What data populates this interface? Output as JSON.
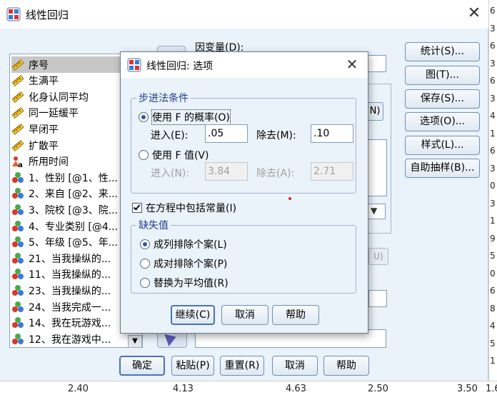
{
  "main": {
    "title": "线性回归",
    "dependent_label": "因变量(D):",
    "block_next_label": "N)",
    "method_arrow": "▼",
    "rule_button_label": "U)",
    "variables": [
      {
        "label": "序号",
        "type": "scale",
        "selected": true
      },
      {
        "label": "生满平",
        "type": "scale"
      },
      {
        "label": "化身认同平均",
        "type": "scale"
      },
      {
        "label": "同一延缓平",
        "type": "scale"
      },
      {
        "label": "早闭平",
        "type": "scale"
      },
      {
        "label": "扩散平",
        "type": "scale"
      },
      {
        "label": "所用时间",
        "type": "string"
      },
      {
        "label": "1、性别 [@1、性...",
        "type": "nominal"
      },
      {
        "label": "2、来自 [@2、来...",
        "type": "nominal"
      },
      {
        "label": "3、院校 [@3、院...",
        "type": "nominal"
      },
      {
        "label": "4、专业类别 [@4...",
        "type": "nominal"
      },
      {
        "label": "5、年级 [@5、年...",
        "type": "nominal"
      },
      {
        "label": "21、当我操纵的...",
        "type": "nominal"
      },
      {
        "label": "11、当我操纵的...",
        "type": "nominal"
      },
      {
        "label": "23、当我操纵的...",
        "type": "nominal"
      },
      {
        "label": "24、当我完成一...",
        "type": "nominal"
      },
      {
        "label": "14、我在玩游戏...",
        "type": "nominal"
      },
      {
        "label": "12、我在游戏中...",
        "type": "nominal"
      }
    ],
    "side_buttons": [
      "统计(S)...",
      "图(T)...",
      "保存(S)...",
      "选项(O)...",
      "样式(L)...",
      "自助抽样(B)..."
    ],
    "bottom_buttons": [
      "确定",
      "粘贴(P)",
      "重置(R)",
      "取消",
      "帮助"
    ]
  },
  "options": {
    "title": "线性回归: 选项",
    "stepping_group": "步进法条件",
    "use_prob_label": "使用 F 的概率(O)",
    "entry_label": "进入(E):",
    "entry_value": ".05",
    "removal_label": "除去(M):",
    "removal_value": ".10",
    "use_f_value_label": "使用 F 值(V)",
    "entry_n_label": "进入(N):",
    "entry_n_value": "3.84",
    "removal_a_label": "除去(A):",
    "removal_a_value": "2.71",
    "include_constant_label": "在方程中包括常量(I)",
    "include_constant_checked": true,
    "missing_group": "缺失值",
    "missing_listwise": "成列排除个案(L)",
    "missing_pairwise": "成对排除个案(P)",
    "missing_mean": "替换为平均值(R)",
    "continue_button": "继续(C)",
    "cancel_button": "取消",
    "help_button": "帮助"
  },
  "background": {
    "right_column": [
      "6",
      "3",
      "6",
      "3",
      "6",
      "3",
      "4",
      "1",
      "6",
      "3",
      "0",
      "3",
      "1",
      "9",
      "5",
      "0",
      "6",
      "8",
      "4",
      "5",
      "1"
    ],
    "bottom_row": [
      "2.40",
      "4.13",
      "4.63",
      "2.50",
      "3.50",
      "1.6"
    ]
  },
  "colors": {
    "dialog_bg": "#eaf2fa",
    "group_title": "#1f3f8f",
    "button_border": "#6f8fb3",
    "selected_item": "#c7c7c7"
  }
}
